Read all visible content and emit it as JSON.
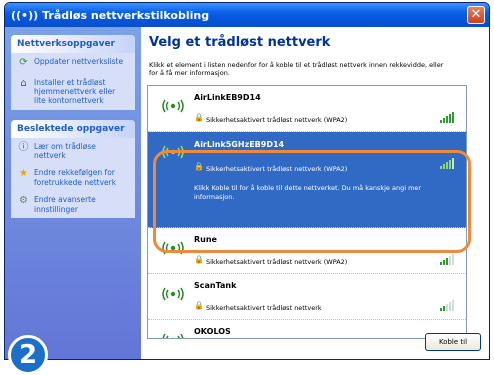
{
  "window": {
    "title": "Trådløs nettverkstilkobling",
    "close_glyph": "✕"
  },
  "sidebar": {
    "network_tasks": {
      "header": "Nettverksoppgaver",
      "items": [
        {
          "label": "Oppdater nettverksliste",
          "icon": "refresh-icon"
        },
        {
          "label": "Installer et trådløst hjemmenettverk eller lite kontornettverk",
          "icon": "home-network-icon"
        }
      ]
    },
    "related_tasks": {
      "header": "Beslektede oppgaver",
      "items": [
        {
          "label": "Lær om trådløse nettverk",
          "icon": "info-icon"
        },
        {
          "label": "Endre rekkefølgen for foretrukkede nettverk",
          "icon": "star-icon"
        },
        {
          "label": "Endre avanserte innstillinger",
          "icon": "gear-icon"
        }
      ]
    }
  },
  "main": {
    "heading": "Velg et trådløst nettverk",
    "instructions": "Klikk et element i listen nedenfor for å koble til et trådløst nettverk innen rekkevidde, eller for å få mer informasjon.",
    "networks": [
      {
        "name": "AirLinkEB9D14",
        "security": "Sikkerhetsaktivert trådløst nettverk (WPA2)",
        "signal": 5,
        "selected": false
      },
      {
        "name": "AirLink5GHzEB9D14",
        "security": "Sikkerhetsaktivert trådløst nettverk (WPA2)",
        "signal": 4,
        "selected": true,
        "hint": "Klikk Koble til for å koble til dette nettverket. Du må kanskje angi mer informasjon."
      },
      {
        "name": "Rune",
        "security": "Sikkerhetsaktivert trådløst nettverk (WPA2)",
        "signal": 3,
        "selected": false
      },
      {
        "name": "ScanTank",
        "security": "Sikkerhetsaktivert trådløst nettverk",
        "signal": 2,
        "selected": false
      },
      {
        "name": "OKOLOS",
        "security": "",
        "signal": 1,
        "selected": false
      }
    ],
    "connect_label": "Koble til"
  },
  "step_badge": "2",
  "colors": {
    "highlight": "#ee8a3a",
    "selection": "#316ac5",
    "titlebar": "#0a5ee8"
  }
}
